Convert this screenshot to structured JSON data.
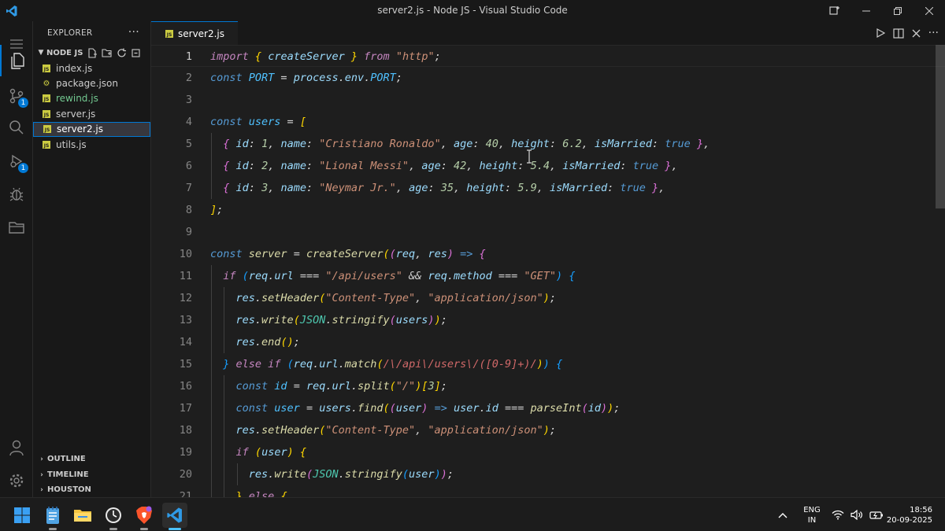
{
  "window": {
    "title": "server2.js - Node JS - Visual Studio Code"
  },
  "activity_bar": {
    "source_control_badge": "1",
    "run_debug_badge": "1"
  },
  "explorer": {
    "header": "EXPLORER",
    "folder": "NODE JS",
    "files": [
      {
        "name": "index.js",
        "type": "js",
        "color": "#cccccc"
      },
      {
        "name": "package.json",
        "type": "json",
        "color": "#cccccc"
      },
      {
        "name": "rewind.js",
        "type": "js",
        "color": "#73c991"
      },
      {
        "name": "server.js",
        "type": "js",
        "color": "#cccccc"
      },
      {
        "name": "server2.js",
        "type": "js",
        "color": "#ffffff",
        "selected": true
      },
      {
        "name": "utils.js",
        "type": "js",
        "color": "#cccccc"
      }
    ],
    "sections": [
      "OUTLINE",
      "TIMELINE",
      "HOUSTON"
    ]
  },
  "tabs": [
    {
      "label": "server2.js",
      "icon_label": "JS"
    }
  ],
  "editor": {
    "current_line": 1,
    "lines": [
      {
        "n": "1",
        "indent": 0,
        "tokens": [
          [
            "kw",
            "import"
          ],
          [
            "p",
            " "
          ],
          [
            "br1",
            "{"
          ],
          [
            "p",
            " "
          ],
          [
            "var",
            "createServer"
          ],
          [
            "p",
            " "
          ],
          [
            "br1",
            "}"
          ],
          [
            "p",
            " "
          ],
          [
            "kw",
            "from"
          ],
          [
            "p",
            " "
          ],
          [
            "str",
            "\"http\""
          ],
          [
            "p",
            ";"
          ]
        ]
      },
      {
        "n": "2",
        "indent": 0,
        "tokens": [
          [
            "def",
            "const"
          ],
          [
            "p",
            " "
          ],
          [
            "const",
            "PORT"
          ],
          [
            "p",
            " = "
          ],
          [
            "var",
            "process"
          ],
          [
            "p",
            "."
          ],
          [
            "var",
            "env"
          ],
          [
            "p",
            "."
          ],
          [
            "const",
            "PORT"
          ],
          [
            "p",
            ";"
          ]
        ]
      },
      {
        "n": "3",
        "indent": 0,
        "tokens": []
      },
      {
        "n": "4",
        "indent": 0,
        "tokens": [
          [
            "def",
            "const"
          ],
          [
            "p",
            " "
          ],
          [
            "const",
            "users"
          ],
          [
            "p",
            " = "
          ],
          [
            "br1",
            "["
          ]
        ]
      },
      {
        "n": "5",
        "indent": 1,
        "tokens": [
          [
            "p",
            "  "
          ],
          [
            "br2",
            "{"
          ],
          [
            "p",
            " "
          ],
          [
            "var",
            "id"
          ],
          [
            "p",
            ": "
          ],
          [
            "num",
            "1"
          ],
          [
            "p",
            ", "
          ],
          [
            "var",
            "name"
          ],
          [
            "p",
            ": "
          ],
          [
            "str",
            "\"Cristiano Ronaldo\""
          ],
          [
            "p",
            ", "
          ],
          [
            "var",
            "age"
          ],
          [
            "p",
            ": "
          ],
          [
            "num",
            "40"
          ],
          [
            "p",
            ", "
          ],
          [
            "var",
            "height"
          ],
          [
            "p",
            ": "
          ],
          [
            "num",
            "6.2"
          ],
          [
            "p",
            ", "
          ],
          [
            "var",
            "isMarried"
          ],
          [
            "p",
            ": "
          ],
          [
            "bool",
            "true"
          ],
          [
            "p",
            " "
          ],
          [
            "br2",
            "}"
          ],
          [
            "p",
            ","
          ]
        ]
      },
      {
        "n": "6",
        "indent": 1,
        "tokens": [
          [
            "p",
            "  "
          ],
          [
            "br2",
            "{"
          ],
          [
            "p",
            " "
          ],
          [
            "var",
            "id"
          ],
          [
            "p",
            ": "
          ],
          [
            "num",
            "2"
          ],
          [
            "p",
            ", "
          ],
          [
            "var",
            "name"
          ],
          [
            "p",
            ": "
          ],
          [
            "str",
            "\"Lional Messi\""
          ],
          [
            "p",
            ", "
          ],
          [
            "var",
            "age"
          ],
          [
            "p",
            ": "
          ],
          [
            "num",
            "42"
          ],
          [
            "p",
            ", "
          ],
          [
            "var",
            "height"
          ],
          [
            "p",
            ": "
          ],
          [
            "num",
            "5.4"
          ],
          [
            "p",
            ", "
          ],
          [
            "var",
            "isMarried"
          ],
          [
            "p",
            ": "
          ],
          [
            "bool",
            "true"
          ],
          [
            "p",
            " "
          ],
          [
            "br2",
            "}"
          ],
          [
            "p",
            ","
          ]
        ]
      },
      {
        "n": "7",
        "indent": 1,
        "tokens": [
          [
            "p",
            "  "
          ],
          [
            "br2",
            "{"
          ],
          [
            "p",
            " "
          ],
          [
            "var",
            "id"
          ],
          [
            "p",
            ": "
          ],
          [
            "num",
            "3"
          ],
          [
            "p",
            ", "
          ],
          [
            "var",
            "name"
          ],
          [
            "p",
            ": "
          ],
          [
            "str",
            "\"Neymar Jr.\""
          ],
          [
            "p",
            ", "
          ],
          [
            "var",
            "age"
          ],
          [
            "p",
            ": "
          ],
          [
            "num",
            "35"
          ],
          [
            "p",
            ", "
          ],
          [
            "var",
            "height"
          ],
          [
            "p",
            ": "
          ],
          [
            "num",
            "5.9"
          ],
          [
            "p",
            ", "
          ],
          [
            "var",
            "isMarried"
          ],
          [
            "p",
            ": "
          ],
          [
            "bool",
            "true"
          ],
          [
            "p",
            " "
          ],
          [
            "br2",
            "}"
          ],
          [
            "p",
            ","
          ]
        ]
      },
      {
        "n": "8",
        "indent": 0,
        "tokens": [
          [
            "br1",
            "]"
          ],
          [
            "p",
            ";"
          ]
        ]
      },
      {
        "n": "9",
        "indent": 0,
        "tokens": []
      },
      {
        "n": "10",
        "indent": 0,
        "tokens": [
          [
            "def",
            "const"
          ],
          [
            "p",
            " "
          ],
          [
            "fn",
            "server"
          ],
          [
            "p",
            " = "
          ],
          [
            "fn",
            "createServer"
          ],
          [
            "br1",
            "("
          ],
          [
            "br2",
            "("
          ],
          [
            "var",
            "req"
          ],
          [
            "p",
            ", "
          ],
          [
            "var",
            "res"
          ],
          [
            "br2",
            ")"
          ],
          [
            "p",
            " "
          ],
          [
            "def",
            "=>"
          ],
          [
            "p",
            " "
          ],
          [
            "br2",
            "{"
          ]
        ]
      },
      {
        "n": "11",
        "indent": 1,
        "tokens": [
          [
            "p",
            "  "
          ],
          [
            "ctl",
            "if"
          ],
          [
            "p",
            " "
          ],
          [
            "br3",
            "("
          ],
          [
            "var",
            "req"
          ],
          [
            "p",
            "."
          ],
          [
            "var",
            "url"
          ],
          [
            "p",
            " === "
          ],
          [
            "str",
            "\"/api/users\""
          ],
          [
            "p",
            " && "
          ],
          [
            "var",
            "req"
          ],
          [
            "p",
            "."
          ],
          [
            "var",
            "method"
          ],
          [
            "p",
            " === "
          ],
          [
            "str",
            "\"GET\""
          ],
          [
            "br3",
            ")"
          ],
          [
            "p",
            " "
          ],
          [
            "br3",
            "{"
          ]
        ]
      },
      {
        "n": "12",
        "indent": 2,
        "tokens": [
          [
            "p",
            "    "
          ],
          [
            "var",
            "res"
          ],
          [
            "p",
            "."
          ],
          [
            "fn",
            "setHeader"
          ],
          [
            "br1",
            "("
          ],
          [
            "str",
            "\"Content-Type\""
          ],
          [
            "p",
            ", "
          ],
          [
            "str",
            "\"application/json\""
          ],
          [
            "br1",
            ")"
          ],
          [
            "p",
            ";"
          ]
        ]
      },
      {
        "n": "13",
        "indent": 2,
        "tokens": [
          [
            "p",
            "    "
          ],
          [
            "var",
            "res"
          ],
          [
            "p",
            "."
          ],
          [
            "fn",
            "write"
          ],
          [
            "br1",
            "("
          ],
          [
            "cls",
            "JSON"
          ],
          [
            "p",
            "."
          ],
          [
            "fn",
            "stringify"
          ],
          [
            "br2",
            "("
          ],
          [
            "var",
            "users"
          ],
          [
            "br2",
            ")"
          ],
          [
            "br1",
            ")"
          ],
          [
            "p",
            ";"
          ]
        ]
      },
      {
        "n": "14",
        "indent": 2,
        "tokens": [
          [
            "p",
            "    "
          ],
          [
            "var",
            "res"
          ],
          [
            "p",
            "."
          ],
          [
            "fn",
            "end"
          ],
          [
            "br1",
            "()"
          ],
          [
            "p",
            ";"
          ]
        ]
      },
      {
        "n": "15",
        "indent": 1,
        "tokens": [
          [
            "p",
            "  "
          ],
          [
            "br3",
            "}"
          ],
          [
            "p",
            " "
          ],
          [
            "ctl",
            "else if"
          ],
          [
            "p",
            " "
          ],
          [
            "br3",
            "("
          ],
          [
            "var",
            "req"
          ],
          [
            "p",
            "."
          ],
          [
            "var",
            "url"
          ],
          [
            "p",
            "."
          ],
          [
            "fn",
            "match"
          ],
          [
            "br1",
            "("
          ],
          [
            "re",
            "/\\/api\\/users\\/([0-9]+)/"
          ],
          [
            "br1",
            ")"
          ],
          [
            "br3",
            ")"
          ],
          [
            "p",
            " "
          ],
          [
            "br3",
            "{"
          ]
        ]
      },
      {
        "n": "16",
        "indent": 2,
        "tokens": [
          [
            "p",
            "    "
          ],
          [
            "def",
            "const"
          ],
          [
            "p",
            " "
          ],
          [
            "const",
            "id"
          ],
          [
            "p",
            " = "
          ],
          [
            "var",
            "req"
          ],
          [
            "p",
            "."
          ],
          [
            "var",
            "url"
          ],
          [
            "p",
            "."
          ],
          [
            "fn",
            "split"
          ],
          [
            "br1",
            "("
          ],
          [
            "str",
            "\"/\""
          ],
          [
            "br1",
            ")"
          ],
          [
            "br1",
            "["
          ],
          [
            "num",
            "3"
          ],
          [
            "br1",
            "]"
          ],
          [
            "p",
            ";"
          ]
        ]
      },
      {
        "n": "17",
        "indent": 2,
        "tokens": [
          [
            "p",
            "    "
          ],
          [
            "def",
            "const"
          ],
          [
            "p",
            " "
          ],
          [
            "const",
            "user"
          ],
          [
            "p",
            " = "
          ],
          [
            "var",
            "users"
          ],
          [
            "p",
            "."
          ],
          [
            "fn",
            "find"
          ],
          [
            "br1",
            "("
          ],
          [
            "br2",
            "("
          ],
          [
            "var",
            "user"
          ],
          [
            "br2",
            ")"
          ],
          [
            "p",
            " "
          ],
          [
            "def",
            "=>"
          ],
          [
            "p",
            " "
          ],
          [
            "var",
            "user"
          ],
          [
            "p",
            "."
          ],
          [
            "var",
            "id"
          ],
          [
            "p",
            " === "
          ],
          [
            "fn",
            "parseInt"
          ],
          [
            "br2",
            "("
          ],
          [
            "var",
            "id"
          ],
          [
            "br2",
            ")"
          ],
          [
            "br1",
            ")"
          ],
          [
            "p",
            ";"
          ]
        ]
      },
      {
        "n": "18",
        "indent": 2,
        "tokens": [
          [
            "p",
            "    "
          ],
          [
            "var",
            "res"
          ],
          [
            "p",
            "."
          ],
          [
            "fn",
            "setHeader"
          ],
          [
            "br1",
            "("
          ],
          [
            "str",
            "\"Content-Type\""
          ],
          [
            "p",
            ", "
          ],
          [
            "str",
            "\"application/json\""
          ],
          [
            "br1",
            ")"
          ],
          [
            "p",
            ";"
          ]
        ]
      },
      {
        "n": "19",
        "indent": 2,
        "tokens": [
          [
            "p",
            "    "
          ],
          [
            "ctl",
            "if"
          ],
          [
            "p",
            " "
          ],
          [
            "br1",
            "("
          ],
          [
            "var",
            "user"
          ],
          [
            "br1",
            ")"
          ],
          [
            "p",
            " "
          ],
          [
            "br1",
            "{"
          ]
        ]
      },
      {
        "n": "20",
        "indent": 3,
        "tokens": [
          [
            "p",
            "      "
          ],
          [
            "var",
            "res"
          ],
          [
            "p",
            "."
          ],
          [
            "fn",
            "write"
          ],
          [
            "br2",
            "("
          ],
          [
            "cls",
            "JSON"
          ],
          [
            "p",
            "."
          ],
          [
            "fn",
            "stringify"
          ],
          [
            "br3",
            "("
          ],
          [
            "var",
            "user"
          ],
          [
            "br3",
            ")"
          ],
          [
            "br2",
            ")"
          ],
          [
            "p",
            ";"
          ]
        ]
      },
      {
        "n": "21",
        "indent": 2,
        "tokens": [
          [
            "p",
            "    "
          ],
          [
            "br1",
            "}"
          ],
          [
            "p",
            " "
          ],
          [
            "ctl",
            "else"
          ],
          [
            "p",
            " "
          ],
          [
            "br1",
            "{"
          ]
        ]
      }
    ]
  },
  "taskbar": {
    "apps": [
      "windows-start",
      "notepad",
      "file-explorer",
      "clock-app",
      "brave-browser",
      "vscode"
    ],
    "language_line1": "ENG",
    "language_line2": "IN",
    "time": "18:56",
    "date": "20-09-2025"
  },
  "colors": {
    "accent": "#0078d4"
  }
}
